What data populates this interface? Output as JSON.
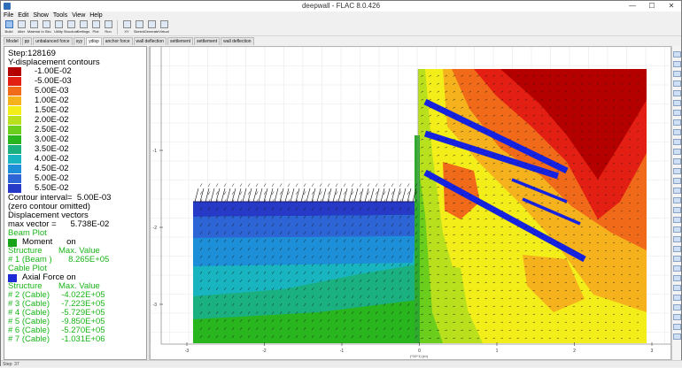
{
  "window": {
    "title": "deepwall - FLAC 8.0.426",
    "minimize": "—",
    "maximize": "☐",
    "close": "✕"
  },
  "menu": [
    "File",
    "Edit",
    "Show",
    "Tools",
    "View",
    "Help"
  ],
  "toolbar": [
    {
      "label": "Build",
      "icon": "build-icon",
      "active": true
    },
    {
      "label": "Alter",
      "icon": "alter-icon",
      "active": false
    },
    {
      "label": "Material",
      "icon": "material-icon",
      "active": false
    },
    {
      "label": "In Situ",
      "icon": "in-situ-icon",
      "active": false
    },
    {
      "label": "Utility",
      "icon": "utility-icon",
      "active": false
    },
    {
      "label": "Structure",
      "icon": "structure-icon",
      "active": false
    },
    {
      "label": "Settings",
      "icon": "settings-icon",
      "active": false
    },
    {
      "label": "Plot",
      "icon": "plot-icon",
      "active": false
    },
    {
      "label": "Run",
      "icon": "run-icon",
      "active": false
    },
    {
      "label": "XY",
      "icon": "xy-icon",
      "active": false
    },
    {
      "label": "Sketch",
      "icon": "sketch-icon",
      "active": false
    },
    {
      "label": "Generate",
      "icon": "generate-icon",
      "active": false
    },
    {
      "label": "Virtual",
      "icon": "virtual-icon",
      "active": false
    }
  ],
  "tabs": [
    "Model",
    "pp",
    "unbalanced force",
    "syy",
    "ydisp",
    "anchor force",
    "wall deflection",
    "settlement",
    "settlement",
    "wall deflection"
  ],
  "active_tab": 4,
  "legend": {
    "step": "Step:128169",
    "contour_title": "Y-displacement contours",
    "contours": [
      {
        "label": "-1.00E-02",
        "color": "#b50000"
      },
      {
        "label": "-5.00E-03",
        "color": "#e21f12"
      },
      {
        "label": "5.00E-03",
        "color": "#f06a19"
      },
      {
        "label": "1.00E-02",
        "color": "#f5b21c"
      },
      {
        "label": "1.50E-02",
        "color": "#f3ee1a"
      },
      {
        "label": "2.00E-02",
        "color": "#b9e01d"
      },
      {
        "label": "2.50E-02",
        "color": "#6bcd1c"
      },
      {
        "label": "3.00E-02",
        "color": "#29b51e"
      },
      {
        "label": "3.50E-02",
        "color": "#1bb07f"
      },
      {
        "label": "4.00E-02",
        "color": "#18b4c0"
      },
      {
        "label": "4.50E-02",
        "color": "#1d8fd8"
      },
      {
        "label": "5.00E-02",
        "color": "#2d64d6"
      },
      {
        "label": "5.50E-02",
        "color": "#273ac7"
      }
    ],
    "contour_interval": "Contour interval=  5.00E-03",
    "zero_omitted": "(zero contour omitted)",
    "disp_vectors": "Displacement vectors",
    "max_vector": "max vector =      5.738E-02",
    "beam_plot": "Beam Plot",
    "moment": "Moment      on",
    "beam_header": "Structure       Max. Value",
    "beam_row": "# 1 (Beam )       8.265E+05",
    "cable_plot": "Cable Plot",
    "axial": "Axial Force on",
    "cable_header": "Structure       Max. Value",
    "cable_rows": [
      "# 2 (Cable)     -4.022E+05",
      "# 3 (Cable)     -7.223E+05",
      "# 4 (Cable)     -5.729E+05",
      "# 5 (Cable)     -9.850E+05",
      "# 6 (Cable)     -5.270E+05",
      "# 7 (Cable)     -1.031E+06"
    ],
    "moment_color": "#19a319",
    "axial_color": "#1d2bd6"
  },
  "plot": {
    "x_ticks": [
      "-3",
      "-2",
      "-1",
      "0",
      "1",
      "2",
      "3"
    ],
    "y_ticks": [
      "-1",
      "-2",
      "-3"
    ],
    "x_unit": "(*10^1) (m)",
    "wall_color": "#2faa2f",
    "anchor_color": "#1522e0"
  },
  "status": "Step: 37"
}
